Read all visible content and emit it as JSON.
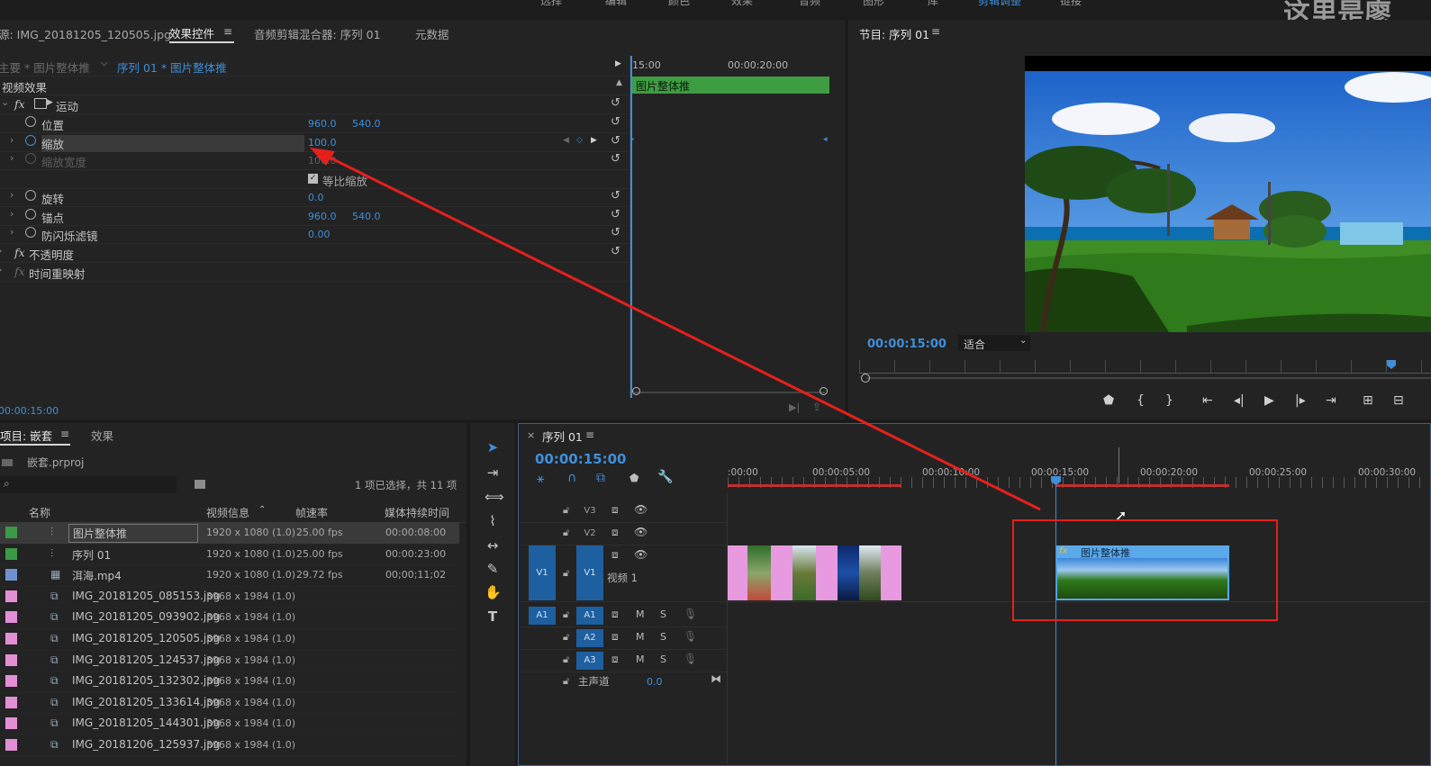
{
  "top_menu": {
    "items": [
      "选择",
      "编辑",
      "颜色",
      "效果",
      "音频",
      "图形",
      "库",
      "剪辑调整",
      "链接"
    ],
    "watermark": "这里是廖"
  },
  "source_panel": {
    "tabs": [
      "源: IMG_20181205_120505.jpg",
      "效果控件",
      "音频剪辑混合器: 序列 01",
      "元数据"
    ],
    "breadcrumb_master": "主要 * 图片整体推",
    "breadcrumb_clip": "序列 01 * 图片整体推",
    "section_title": "视频效果",
    "motion_label": "运动",
    "properties": [
      {
        "label": "位置",
        "v1": "960.0",
        "v2": "540.0"
      },
      {
        "label": "缩放",
        "v1": "100.0",
        "v2": ""
      },
      {
        "label": "缩放宽度",
        "v1": "100.0",
        "v2": ""
      },
      {
        "label": "等比缩放",
        "v1": "",
        "v2": ""
      },
      {
        "label": "旋转",
        "v1": "0.0",
        "v2": ""
      },
      {
        "label": "锚点",
        "v1": "960.0",
        "v2": "540.0"
      },
      {
        "label": "防闪烁滤镜",
        "v1": "0.00",
        "v2": ""
      }
    ],
    "opacity_label": "不透明度",
    "time_remap_label": "时间重映射",
    "mini_ruler": [
      "15:00",
      "00:00:20:00"
    ],
    "clip_bar_label": "图片整体推",
    "timecode": "00:00:15:00"
  },
  "program_monitor": {
    "title": "节目: 序列 01",
    "timecode": "00:00:15:00",
    "fit_label": "适合"
  },
  "project_panel": {
    "tabs": [
      "项目: 嵌套",
      "效果"
    ],
    "project_file": "嵌套.prproj",
    "search_placeholder": "",
    "selection_info": "1 项已选择，共 11 项",
    "columns": [
      "名称",
      "视频信息",
      "帧速率",
      "媒体持续时间"
    ],
    "rows": [
      {
        "name": "图片整体推",
        "video": "1920 x 1080 (1.0)",
        "fps": "25.00 fps",
        "dur": "00:00:08:00",
        "color": "#3a9a46",
        "icon": "seq"
      },
      {
        "name": "序列 01",
        "video": "1920 x 1080 (1.0)",
        "fps": "25.00 fps",
        "dur": "00:00:23:00",
        "color": "#3a9a46",
        "icon": "seq"
      },
      {
        "name": "洱海.mp4",
        "video": "1920 x 1080 (1.0)",
        "fps": "29.72 fps",
        "dur": "00;00;11;02",
        "color": "#6f93d2",
        "icon": "vid"
      },
      {
        "name": "IMG_20181205_085153.jpg",
        "video": "3968 x 1984 (1.0)",
        "fps": "",
        "dur": "",
        "color": "#e38fd6",
        "icon": "img"
      },
      {
        "name": "IMG_20181205_093902.jpg",
        "video": "3968 x 1984 (1.0)",
        "fps": "",
        "dur": "",
        "color": "#e38fd6",
        "icon": "img"
      },
      {
        "name": "IMG_20181205_120505.jpg",
        "video": "3968 x 1984 (1.0)",
        "fps": "",
        "dur": "",
        "color": "#e38fd6",
        "icon": "img"
      },
      {
        "name": "IMG_20181205_124537.jpg",
        "video": "3968 x 1984 (1.0)",
        "fps": "",
        "dur": "",
        "color": "#e38fd6",
        "icon": "img"
      },
      {
        "name": "IMG_20181205_132302.jpg",
        "video": "3968 x 1984 (1.0)",
        "fps": "",
        "dur": "",
        "color": "#e38fd6",
        "icon": "img"
      },
      {
        "name": "IMG_20181205_133614.jpg",
        "video": "3968 x 1984 (1.0)",
        "fps": "",
        "dur": "",
        "color": "#e38fd6",
        "icon": "img"
      },
      {
        "name": "IMG_20181205_144301.jpg",
        "video": "3968 x 1984 (1.0)",
        "fps": "",
        "dur": "",
        "color": "#e38fd6",
        "icon": "img"
      },
      {
        "name": "IMG_20181206_125937.jpg",
        "video": "3968 x 1984 (1.0)",
        "fps": "",
        "dur": "",
        "color": "#e38fd6",
        "icon": "img"
      }
    ]
  },
  "timeline": {
    "title": "序列 01",
    "timecode": "00:00:15:00",
    "ruler": [
      ":00:00",
      "00:00:05:00",
      "00:00:10:00",
      "00:00:15:00",
      "00:00:20:00",
      "00:00:25:00",
      "00:00:30:00"
    ],
    "tracks": {
      "v3": "V3",
      "v2": "V2",
      "v1_src": "V1",
      "v1": "V1",
      "v1_name": "视频 1",
      "a1_src": "A1",
      "a1": "A1",
      "a2": "A2",
      "a3": "A3",
      "master": "主声道",
      "master_value": "0.0",
      "mute": "M",
      "solo": "S"
    },
    "nested_clip_label": "图片整体推"
  },
  "colors": {
    "accent": "#3f8fdb",
    "annotation": "#e5201c",
    "v1_clip": "#e89ae0",
    "fx_clip": "#5aa9e8",
    "effect_bar": "#3e9c41"
  }
}
